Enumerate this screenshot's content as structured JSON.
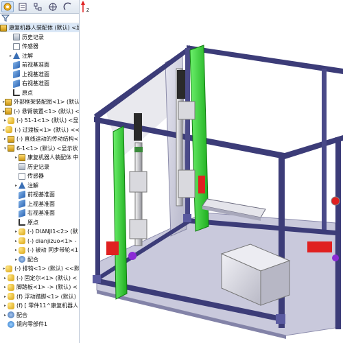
{
  "tree": {
    "root": {
      "label": "康复机器人装配体 (默认) <显"
    },
    "items": [
      {
        "label": "历史记录",
        "icon": "history-icon"
      },
      {
        "label": "传感器",
        "icon": "sensor-icon"
      },
      {
        "label": "注解",
        "icon": "annotation-icon",
        "expand": "▸"
      },
      {
        "label": "前视基准面",
        "icon": "plane-icon"
      },
      {
        "label": "上视基准面",
        "icon": "plane-icon"
      },
      {
        "label": "右视基准面",
        "icon": "plane-icon"
      },
      {
        "label": "原点",
        "icon": "origin-icon"
      },
      {
        "label": "外部框架装配图<1> (默认",
        "icon": "assembly-icon",
        "expand": "▸"
      },
      {
        "label": "(-) 悬臂装置<1> (默认) <",
        "icon": "assembly-icon",
        "expand": "▸"
      },
      {
        "label": "(-) 51-1<1> (默认) <显",
        "icon": "part-icon",
        "expand": "▸"
      },
      {
        "label": "(-) 过渡板<1> (默认) <<",
        "icon": "part-icon",
        "expand": "▸"
      },
      {
        "label": "(-) 直线运动的传动结构<",
        "icon": "assembly-icon",
        "expand": "▸"
      },
      {
        "label": "6-1<1> (默认) <显示状",
        "icon": "assembly-icon",
        "expand": "▾"
      },
      {
        "label": "康复机器人装配体 中",
        "icon": "assembly-icon",
        "expand": "▸"
      },
      {
        "label": "历史记录",
        "icon": "history-icon"
      },
      {
        "label": "传感器",
        "icon": "sensor-icon"
      },
      {
        "label": "注解",
        "icon": "annotation-icon",
        "expand": "▸"
      },
      {
        "label": "前视基准面",
        "icon": "plane-icon"
      },
      {
        "label": "上视基准面",
        "icon": "plane-icon"
      },
      {
        "label": "右视基准面",
        "icon": "plane-icon"
      },
      {
        "label": "原点",
        "icon": "origin-icon"
      },
      {
        "label": "(-) DIANJI1<2> (默",
        "icon": "part-icon",
        "expand": "▸"
      },
      {
        "label": "(-) dianjizuo<1> -",
        "icon": "part-icon",
        "expand": "▸"
      },
      {
        "label": "(-) 被动 同步带轮<1",
        "icon": "part-icon",
        "expand": "▸"
      },
      {
        "label": "配合",
        "icon": "mates-icon",
        "expand": "▸"
      },
      {
        "label": "(-) 排钩<1> (默认) <<默",
        "icon": "part-icon",
        "expand": "▸"
      },
      {
        "label": "(-) 固定尔<1> (默认) <",
        "icon": "part-icon",
        "expand": "▸"
      },
      {
        "label": "脚踏板<1> -> (默认) <",
        "icon": "part-icon",
        "expand": "▸"
      },
      {
        "label": "(f) 浮动踏脚<1> (默认)",
        "icon": "part-icon",
        "expand": "▸"
      },
      {
        "label": "(f) [ 零件11^康复机器人",
        "icon": "part-icon",
        "expand": "▸"
      },
      {
        "label": "配合",
        "icon": "mates-icon",
        "expand": "▸"
      },
      {
        "label": "镜向零部件1",
        "icon": "mirror-icon"
      }
    ]
  },
  "triad": {
    "z_label": "Z"
  },
  "colors": {
    "frame": "#3c3c78",
    "green": "#2bd62b",
    "red": "#e02020",
    "panel": "#c8c8d8"
  }
}
